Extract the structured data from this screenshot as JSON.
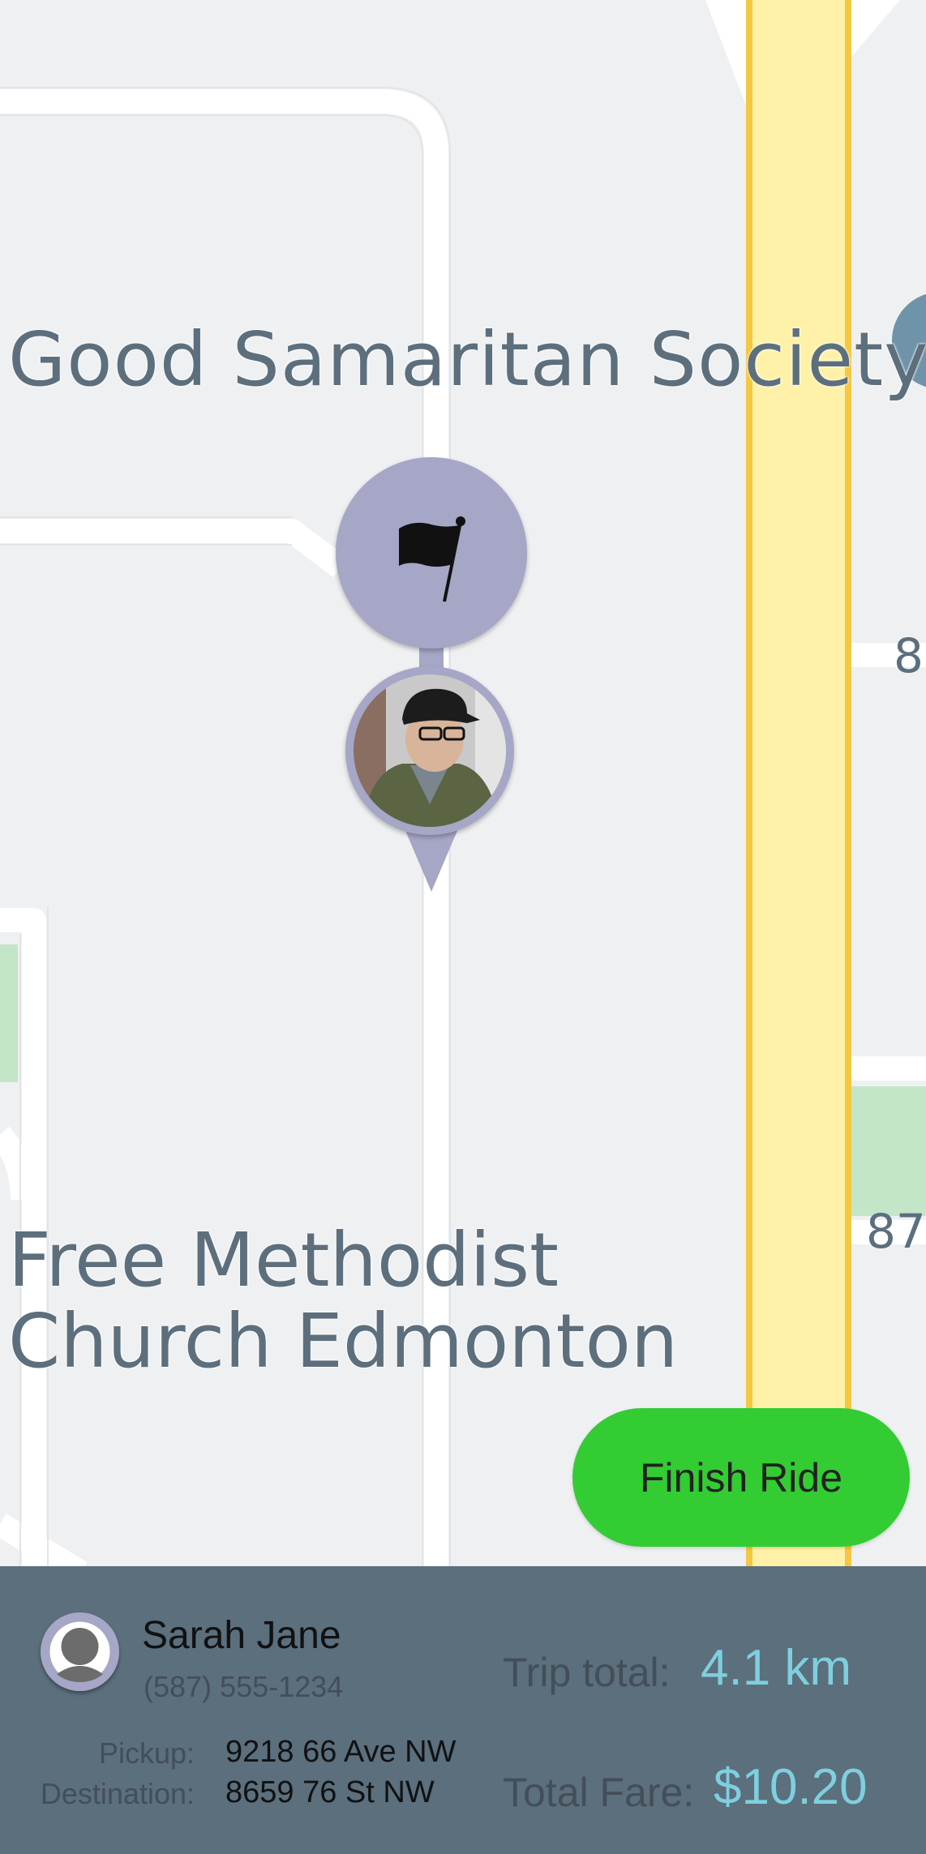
{
  "map": {
    "labels": {
      "good_samaritan": "Good Samaritan Society",
      "free_methodist": "Free Methodist\nChurch Edmonton",
      "road_num_1": "8",
      "road_num_2": "87"
    }
  },
  "actions": {
    "finish_ride": "Finish Ride"
  },
  "rider": {
    "name": "Sarah Jane",
    "phone": "(587) 555-1234"
  },
  "trip": {
    "pickup_label": "Pickup:",
    "pickup_value": "9218 66 Ave NW",
    "destination_label": "Destination:",
    "destination_value": "8659 76 St NW",
    "total_label": "Trip total:",
    "total_value": "4.1 km",
    "fare_label": "Total Fare:",
    "fare_value": "$10.20"
  },
  "colors": {
    "panel_bg": "#5b6f7d",
    "accent": "#7fcfde",
    "finish_button": "#33cc33",
    "pin": "#a6a6c6",
    "highway": "#fff2a8"
  },
  "icons": {
    "destination_marker": "flag-icon",
    "rider_avatar": "user-icon"
  }
}
